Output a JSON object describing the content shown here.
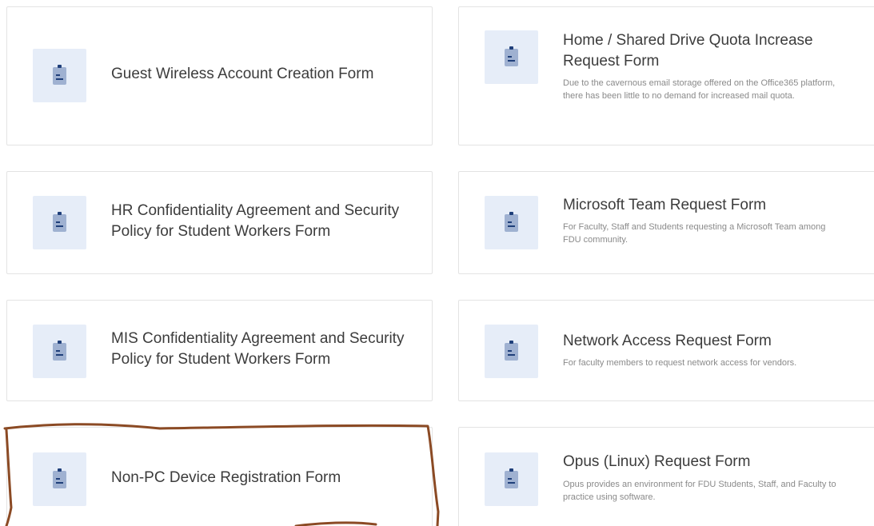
{
  "colors": {
    "icon_tile": "#e6edf8",
    "icon": "#9fb1d1",
    "icon_dark": "#1f3f7a",
    "annotation": "#8b4a24"
  },
  "icon_name": "clipboard-icon",
  "cards": [
    {
      "title": "Guest Wireless Account Creation Form",
      "description": ""
    },
    {
      "title": "Home / Shared Drive Quota Increase Request Form",
      "description": "Due to the cavernous email storage offered on the Office365 platform, there has been little to no demand for increased mail quota."
    },
    {
      "title": "HR Confidentiality Agreement and Security Policy for Student Workers Form",
      "description": ""
    },
    {
      "title": "Microsoft Team Request Form",
      "description": "For Faculty, Staff and Students requesting a Microsoft Team among FDU community."
    },
    {
      "title": "MIS Confidentiality Agreement and Security Policy for Student Workers Form",
      "description": ""
    },
    {
      "title": "Network Access Request Form",
      "description": "For faculty members to request network access for vendors."
    },
    {
      "title": "Non-PC Device Registration Form",
      "description": ""
    },
    {
      "title": "Opus (Linux) Request Form",
      "description": "Opus provides an environment for FDU Students, Staff, and Faculty to practice using software."
    }
  ]
}
